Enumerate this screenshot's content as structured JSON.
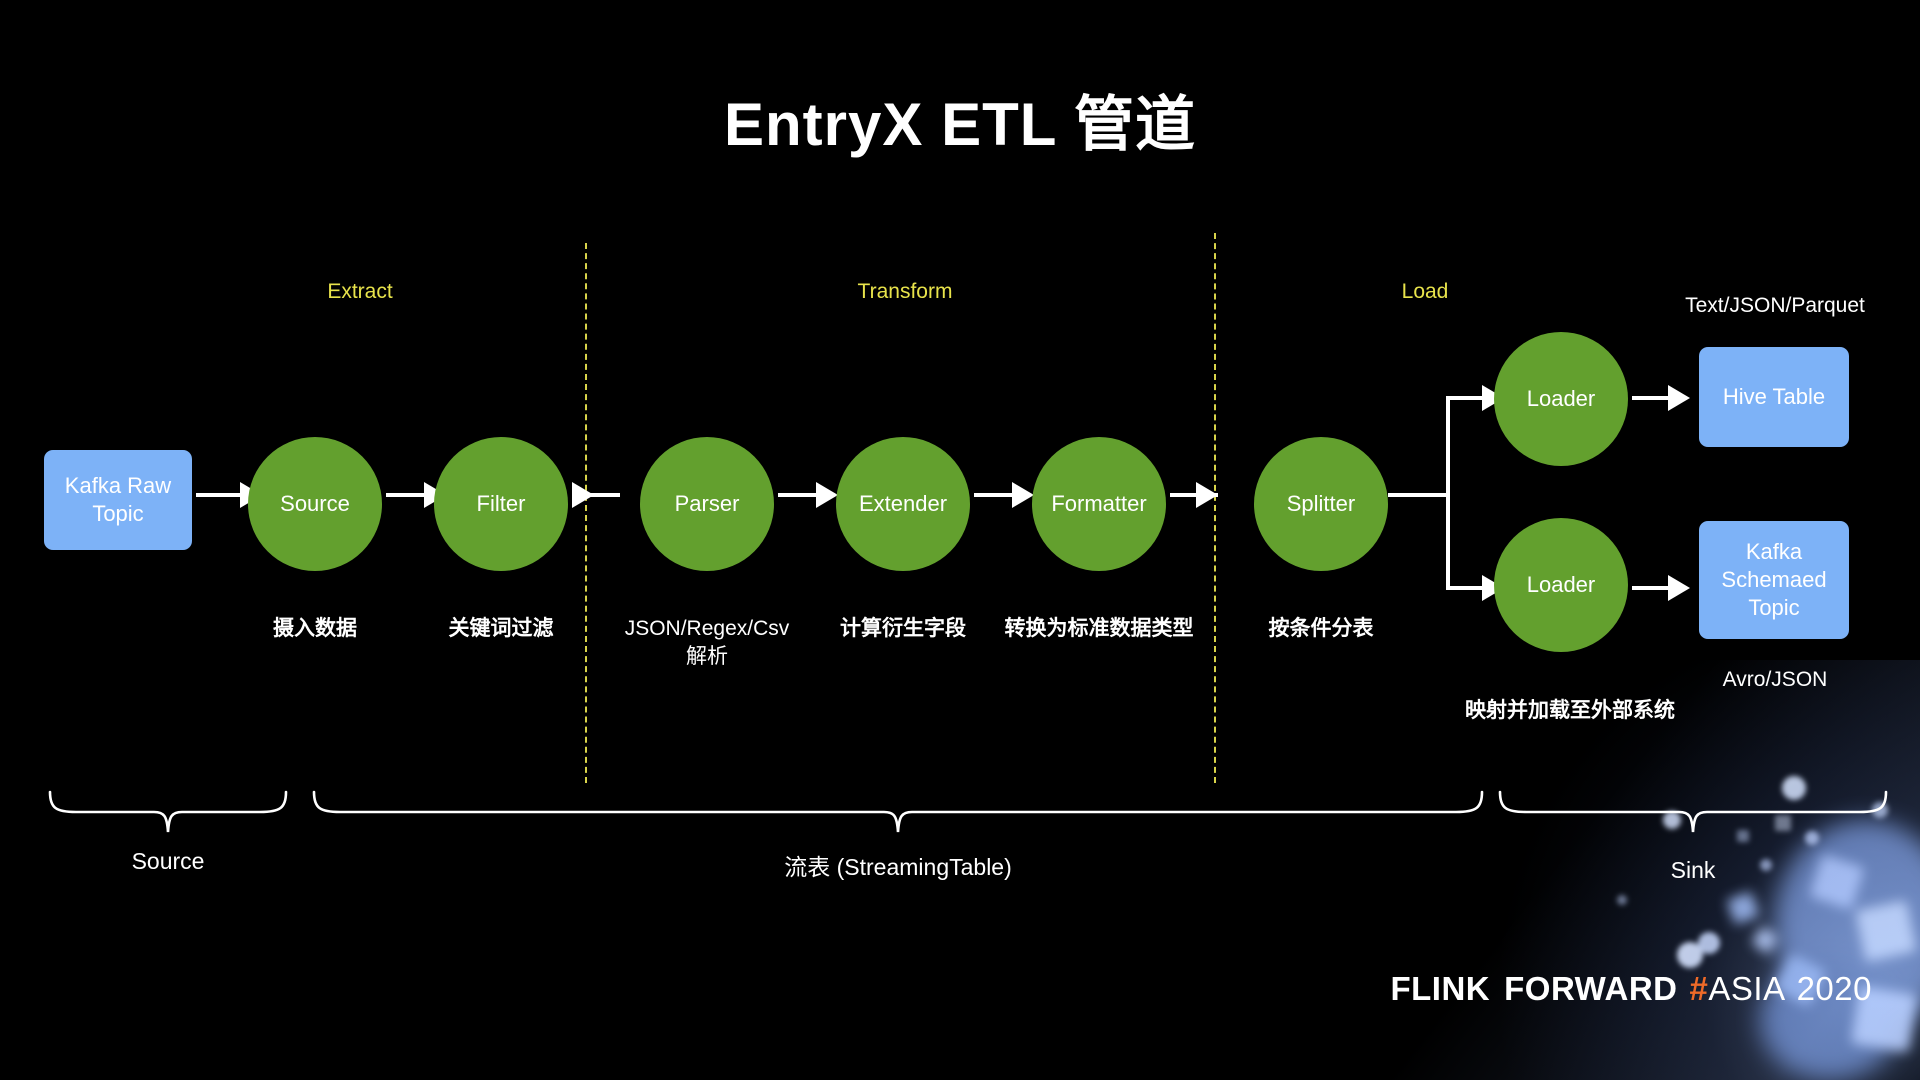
{
  "slide": {
    "title": "EntryX ETL 管道",
    "background_color": "#000000"
  },
  "colors": {
    "node_green": "#63a02e",
    "node_blue": "#7db2f7",
    "phase_yellow": "#e8e34b",
    "accent_orange": "#ef6a28",
    "text_white": "#ffffff"
  },
  "phases": [
    {
      "label": "Extract"
    },
    {
      "label": "Transform"
    },
    {
      "label": "Load"
    }
  ],
  "nodes": {
    "kafka_raw_topic": "Kafka Raw\nTopic",
    "source": "Source",
    "filter": "Filter",
    "parser": "Parser",
    "extender": "Extender",
    "formatter": "Formatter",
    "splitter": "Splitter",
    "loader_top": "Loader",
    "loader_bottom": "Loader",
    "hive_table": "Hive Table",
    "kafka_schemaed_topic": "Kafka\nSchemaed\nTopic"
  },
  "captions": {
    "source": "摄入数据",
    "filter": "关键词过滤",
    "parser": "JSON/Regex/Csv\n解析",
    "extender": "计算衍生字段",
    "formatter": "转换为标准数据类型",
    "splitter": "按条件分表",
    "loaders": "映射并加载至外部系统",
    "hive_format": "Text/JSON/Parquet",
    "kafka_format": "Avro/JSON"
  },
  "groups": [
    {
      "label": "Source"
    },
    {
      "label": "流表 (StreamingTable)"
    },
    {
      "label": "Sink"
    }
  ],
  "footer": {
    "flink": "FLINK",
    "forward": "FORWARD",
    "hash": "#",
    "asia": "ASIA",
    "year": "2020"
  }
}
